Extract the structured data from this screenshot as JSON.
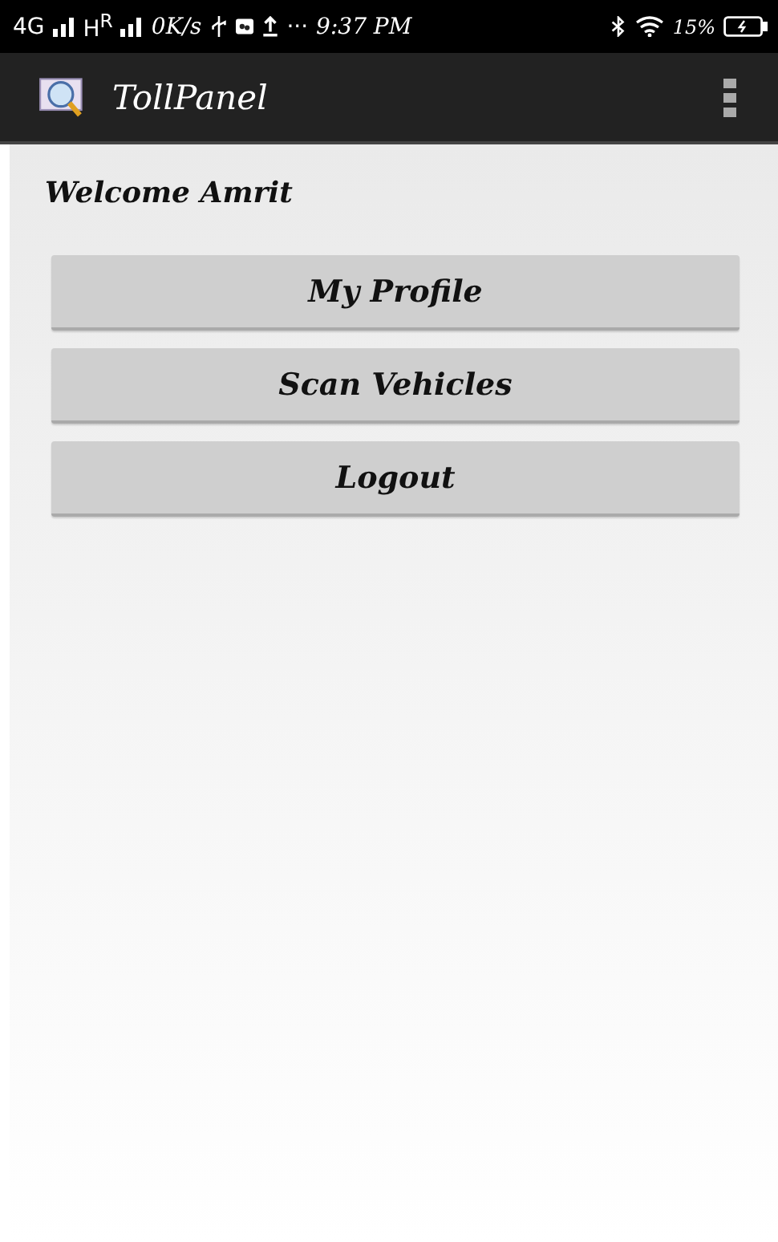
{
  "status_bar": {
    "network_1": "4G",
    "network_2": "H$^{R}$",
    "speed": "0K/s",
    "more": "···",
    "time": "9:37 PM",
    "battery": "15%"
  },
  "app_bar": {
    "title": "TollPanel"
  },
  "welcome": "Welcome Amrit",
  "buttons": [
    "My Profile",
    "Scan Vehicles",
    "Logout"
  ]
}
